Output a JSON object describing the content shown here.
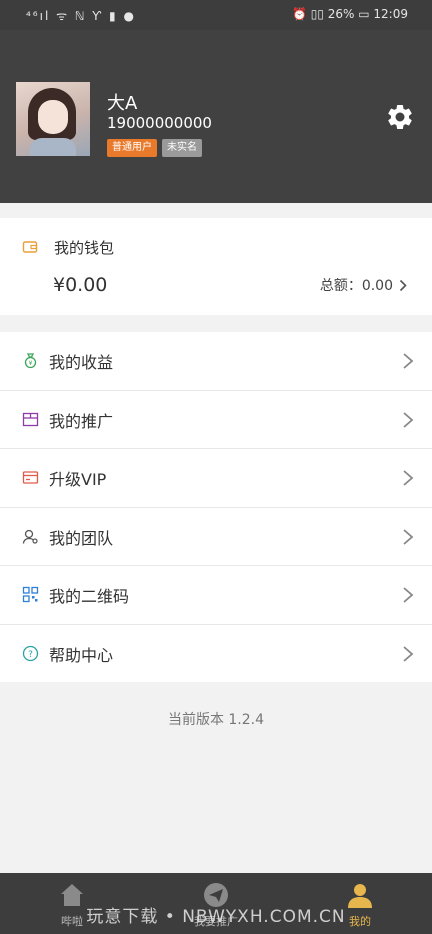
{
  "status_bar": {
    "left_icons": "⁴⁶ıl ᯤ ℕ Ƴ ▮ ●",
    "battery": "26%",
    "time": "12:09"
  },
  "profile": {
    "name": "大A",
    "phone": "19000000000",
    "badge_user": "普通用户",
    "badge_auth": "未实名"
  },
  "wallet": {
    "title": "我的钱包",
    "amount": "¥0.00",
    "total_label": "总额：0.00"
  },
  "menu": [
    {
      "label": "我的收益",
      "icon": "money-bag-icon",
      "color": "#3aa55a"
    },
    {
      "label": "我的推广",
      "icon": "promotion-box-icon",
      "color": "#8e3ba8"
    },
    {
      "label": "升级VIP",
      "icon": "vip-card-icon",
      "color": "#e05a4a"
    },
    {
      "label": "我的团队",
      "icon": "team-person-icon",
      "color": "#555555"
    },
    {
      "label": "我的二维码",
      "icon": "qr-code-icon",
      "color": "#2f7fd6"
    },
    {
      "label": "帮助中心",
      "icon": "help-circle-icon",
      "color": "#2aa3a3"
    }
  ],
  "version": "当前版本 1.2.4",
  "tabs": [
    {
      "label": "哔啦",
      "icon": "home-icon"
    },
    {
      "label": "我要推广",
      "icon": "paper-plane-icon"
    },
    {
      "label": "我的",
      "icon": "user-icon",
      "active": true
    }
  ],
  "watermark": "玩意下载 • NBWYXH.COM.CN",
  "colors": {
    "header_bg": "#414141",
    "badge_user": "#e9792b",
    "badge_auth": "#9a9a9a",
    "tab_active": "#e7b64d"
  }
}
